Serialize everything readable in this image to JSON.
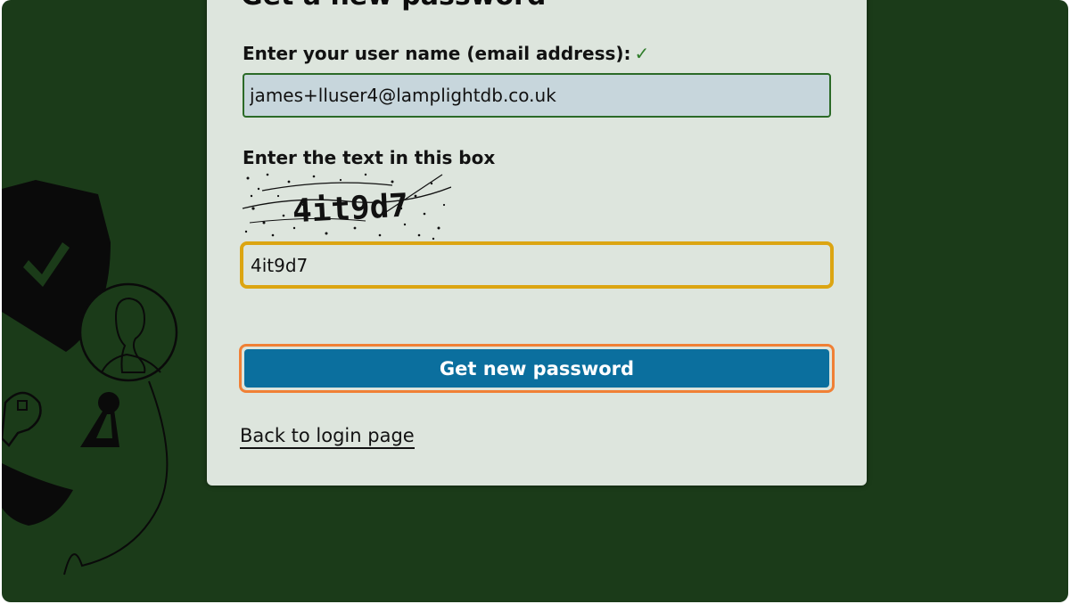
{
  "form": {
    "title": "Get a new password",
    "username_label": "Enter your user name (email address):",
    "username_check": "✓",
    "username_value": "james+lluser4@lamplightdb.co.uk",
    "captcha_label": "Enter the text in this box",
    "captcha_text": "4it9d7",
    "captcha_value": "4it9d7",
    "submit_label": "Get new password",
    "back_link": "Back to login page"
  },
  "colors": {
    "background": "#1b3b19",
    "card": "#dde5dd",
    "button": "#0b6f9e",
    "focus_ring_input": "#dca512",
    "focus_ring_button": "#f08035",
    "valid_check": "#2f7d2a"
  },
  "icons": [
    "shield-check-icon",
    "user-avatar-icon",
    "key-icon",
    "keyhole-icon"
  ]
}
